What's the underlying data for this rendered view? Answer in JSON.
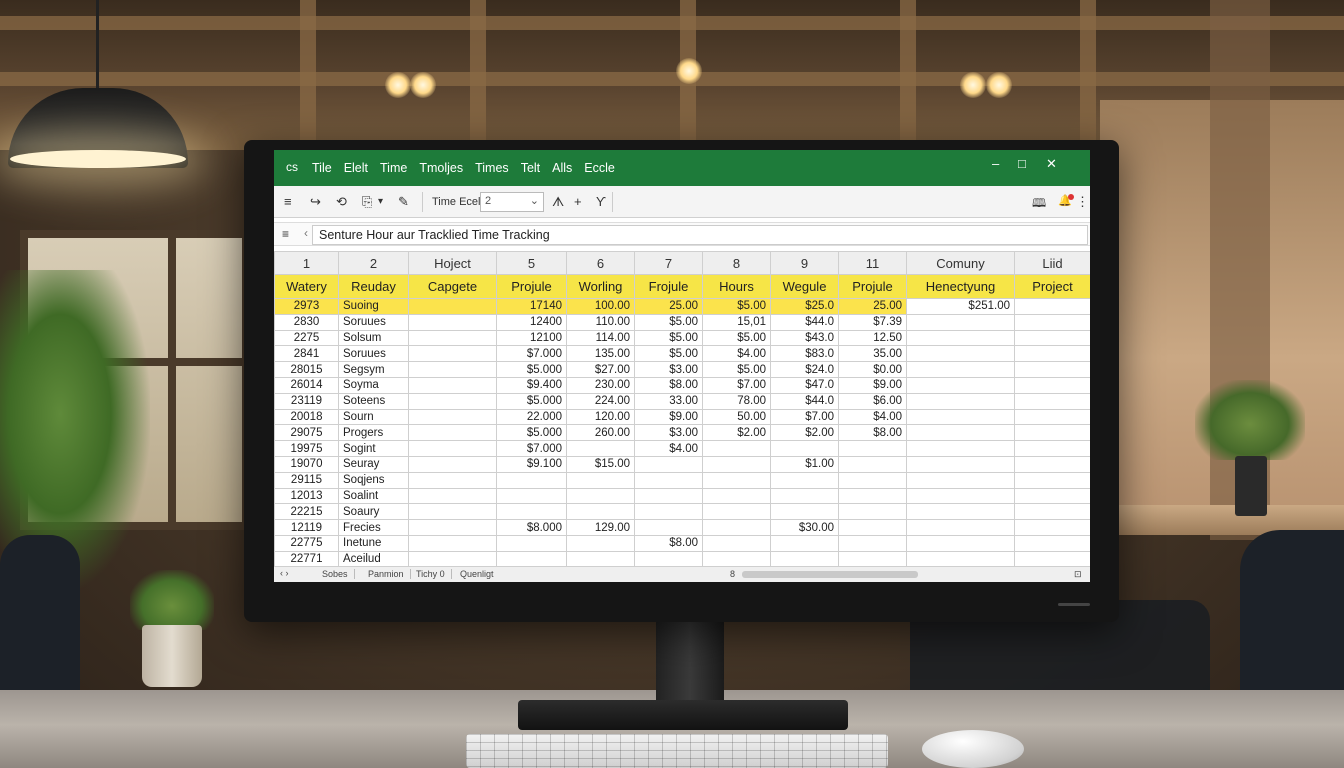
{
  "window": {
    "app_icon": "cs",
    "menu": [
      "Tile",
      "Elelt",
      "Time",
      "Tmoljes",
      "Times",
      "Telt",
      "Alls",
      "Eccle"
    ],
    "controls": {
      "minimize": "–",
      "maximize": "□",
      "close": "✕"
    }
  },
  "ribbon": {
    "menu_icon": "≡",
    "redo_icon": "↪",
    "refresh_icon": "⟲",
    "paste_icon": "⎘",
    "dropdown_icon": "▾",
    "pen_icon": "✎",
    "name_label": "Time Ecel",
    "name_value": "2",
    "select_chevron": "⌄",
    "sort_icon": "ᗑ",
    "plus_icon": "+",
    "filter_icon": "Ƴ",
    "book_icon": "🕮",
    "bell_icon": "🔔",
    "more_icon": "⋮"
  },
  "formula_bar": {
    "menu_icon": "≡",
    "chevron": "‹",
    "content": "Senture Hour aur Tracklied Time Tracking"
  },
  "sheet": {
    "column_headers": [
      "1",
      "2",
      "Hoject",
      "5",
      "6",
      "7",
      "8",
      "9",
      "11",
      "Comuny",
      "Liid"
    ],
    "header_row": [
      "Watery",
      "Reuday",
      "Capgete",
      "Projule",
      "Worling",
      "Frojule",
      "Hours",
      "Wegule",
      "Projule",
      "Henectyung",
      "Project"
    ],
    "rows": [
      [
        "2973",
        "Suoing",
        "",
        "17140",
        "100.00",
        "25.00",
        "$5.00",
        "$25.0",
        "25.00",
        "$251.00",
        ""
      ],
      [
        "2830",
        "Soruues",
        "",
        "12400",
        "110.00",
        "$5.00",
        "15,01",
        "$44.0",
        "$7.39",
        "",
        ""
      ],
      [
        "2275",
        "Solsum",
        "",
        "12100",
        "114.00",
        "$5.00",
        "$5.00",
        "$43.0",
        "12.50",
        "",
        ""
      ],
      [
        "2841",
        "Soruues",
        "",
        "$7.000",
        "135.00",
        "$5.00",
        "$4.00",
        "$83.0",
        "35.00",
        "",
        ""
      ],
      [
        "28015",
        "Segsym",
        "",
        "$5.000",
        "$27.00",
        "$3.00",
        "$5.00",
        "$24.0",
        "$0.00",
        "",
        ""
      ],
      [
        "26014",
        "Soyma",
        "",
        "$9.400",
        "230.00",
        "$8.00",
        "$7.00",
        "$47.0",
        "$9.00",
        "",
        ""
      ],
      [
        "23119",
        "Soteens",
        "",
        "$5.000",
        "224.00",
        "33.00",
        "78.00",
        "$44.0",
        "$6.00",
        "",
        ""
      ],
      [
        "20018",
        "Sourn",
        "",
        "22.000",
        "120.00",
        "$9.00",
        "50.00",
        "$7.00",
        "$4.00",
        "",
        ""
      ],
      [
        "29075",
        "Progers",
        "",
        "$5.000",
        "260.00",
        "$3.00",
        "$2.00",
        "$2.00",
        "$8.00",
        "",
        ""
      ],
      [
        "19975",
        "Sogint",
        "",
        "$7.000",
        "",
        "$4.00",
        "",
        "",
        "",
        "",
        ""
      ],
      [
        "19070",
        "Seuray",
        "",
        "$9.100",
        "$15.00",
        "",
        "",
        "$1.00",
        "",
        "",
        ""
      ],
      [
        "29115",
        "Soqjens",
        "",
        "",
        "",
        "",
        "",
        "",
        "",
        "",
        ""
      ],
      [
        "12013",
        "Soalint",
        "",
        "",
        "",
        "",
        "",
        "",
        "",
        "",
        ""
      ],
      [
        "22215",
        "Soaury",
        "",
        "",
        "",
        "",
        "",
        "",
        "",
        "",
        ""
      ],
      [
        "12119",
        "Frecies",
        "",
        "$8.000",
        "129.00",
        "",
        "",
        "$30.00",
        "",
        "",
        ""
      ],
      [
        "22775",
        "Inetune",
        "",
        "",
        "",
        "$8.00",
        "",
        "",
        "",
        "",
        ""
      ],
      [
        "22771",
        "Aceilud",
        "",
        "",
        "",
        "",
        "",
        "",
        "",
        "",
        ""
      ]
    ]
  },
  "tabs": {
    "nav": "‹ ›",
    "items": [
      "Sobes",
      "Panmion",
      "Tichy 0",
      "Quenligt"
    ],
    "zoom": "8",
    "corner": "⊡"
  },
  "colors": {
    "titlebar": "#1e7b3a",
    "header_row": "#f6e547",
    "highlight_row": "#fbe34c"
  }
}
